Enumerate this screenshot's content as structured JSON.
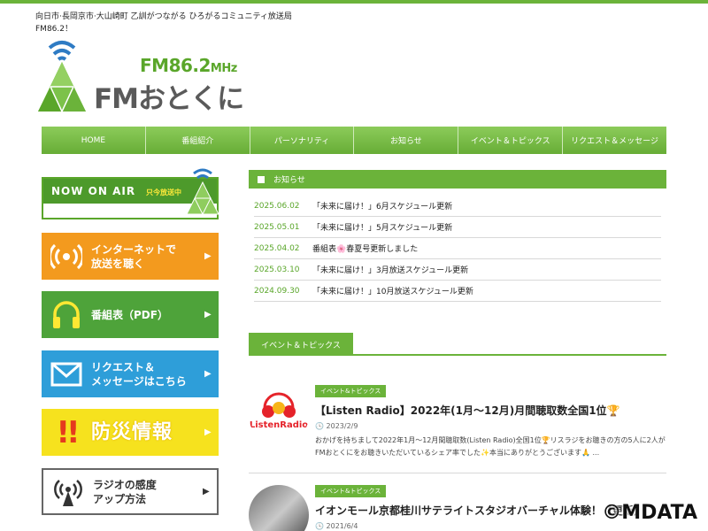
{
  "site": {
    "tagline": "向日市·長岡京市·大山崎町 乙訓がつながる ひろがるコミュニティ放送局　FM86.2！",
    "logo_freq": "FM86.2",
    "logo_unit": "MHz",
    "logo_name": "FMおとくに"
  },
  "nav": [
    "HOME",
    "番組紹介",
    "パーソナリティ",
    "お知らせ",
    "イベント＆トピックス",
    "リクエスト＆メッセージ"
  ],
  "sidebar": {
    "onair_label": "NOW ON AIR",
    "onair_status": "只今放送中",
    "internet_label": "インターネットで\n放送を聴く",
    "program_label": "番組表（PDF）",
    "request_label": "リクエスト＆\nメッセージはこちら",
    "disaster_label": "防災情報",
    "reception_label": "ラジオの感度\nアップ方法"
  },
  "news": {
    "heading": "お知らせ",
    "items": [
      {
        "date": "2025.06.02",
        "title": "「未来に届け！」6月スケジュール更新"
      },
      {
        "date": "2025.05.01",
        "title": "「未来に届け！」5月スケジュール更新"
      },
      {
        "date": "2025.04.02",
        "title": "番組表🌸春夏号更新しました"
      },
      {
        "date": "2025.03.10",
        "title": "「未来に届け！」3月放送スケジュール更新"
      },
      {
        "date": "2024.09.30",
        "title": "「未来に届け！」10月放送スケジュール更新"
      }
    ]
  },
  "events": {
    "heading": "イベント＆トピックス",
    "items": [
      {
        "badge": "イベント&トピックス",
        "title": "【Listen Radio】2022年(1月～12月)月間聴取数全国1位🏆",
        "date": "2023/2/9",
        "desc": "おかげを持ちまして2022年1月～12月間聴取数(Listen Radio)全国1位🏆リスラジをお聴きの方の5人に2人がFMおとくにをお聴きいただいているシェア率でした✨本当にありがとうございます🙏 ..."
      },
      {
        "badge": "イベント&トピックス",
        "title": "イオンモール京都桂川サテライトスタジオバーチャル体験！【更新】",
        "date": "2021/6/4",
        "desc": ""
      }
    ]
  },
  "listen_logo": "ListenRadio",
  "watermark": "©MDATA",
  "colors": {
    "green": "#6bb33a",
    "orange": "#f39a1e",
    "blue": "#2e9ed9",
    "yellow": "#f6e21e"
  }
}
